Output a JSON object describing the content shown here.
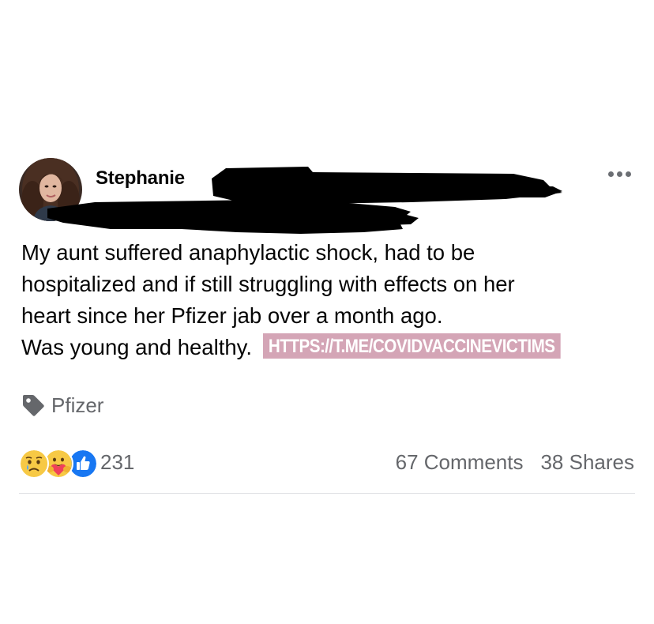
{
  "post": {
    "author_name": "Stephanie",
    "body_lines": [
      "My aunt suffered anaphylactic shock, had to be",
      "hospitalized and if still struggling with effects on her",
      "heart since her Pfizer jab over a month ago.",
      "Was young and healthy."
    ],
    "link_text": "HTTPS://T.ME/COVIDVACCINEVICTIMS",
    "tag_label": "Pfizer",
    "reaction_count": "231",
    "comments_label": "67 Comments",
    "shares_label": "38 Shares",
    "reaction_types": [
      "sad-reaction",
      "care-reaction",
      "like-reaction"
    ],
    "colors": {
      "link_highlight": "#d4a5b6",
      "like_blue": "#1877f2",
      "secondary_text": "#65676b",
      "reaction_yellow": "#f7c945"
    }
  }
}
